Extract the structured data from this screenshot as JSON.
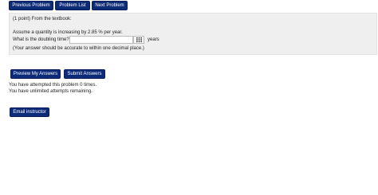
{
  "nav": {
    "previous_label": "Previous Problem",
    "list_label": "Problem List",
    "next_label": "Next Problem"
  },
  "problem": {
    "intro": "(1 point) From the textbook:",
    "assume": "Assume a quantity is increasing by 2.85 % per year.",
    "question": "What is the doubling time?",
    "answer_value": "",
    "answer_placeholder": "",
    "units": "years",
    "hint": "(Your answer should be accurate to within one decimal place.)",
    "equation_editor_icon": "keypad-grid-icon"
  },
  "actions": {
    "preview_label": "Preview My Answers",
    "submit_label": "Submit Answers"
  },
  "status": {
    "attempts": "You have attempted this problem 0 times.",
    "remaining": "You have unlimited attempts remaining."
  },
  "email": {
    "label": "Email instructor"
  },
  "colors": {
    "button_bg": "#0e2b78",
    "button_text": "#ffffff",
    "problem_bg": "#efefef"
  }
}
